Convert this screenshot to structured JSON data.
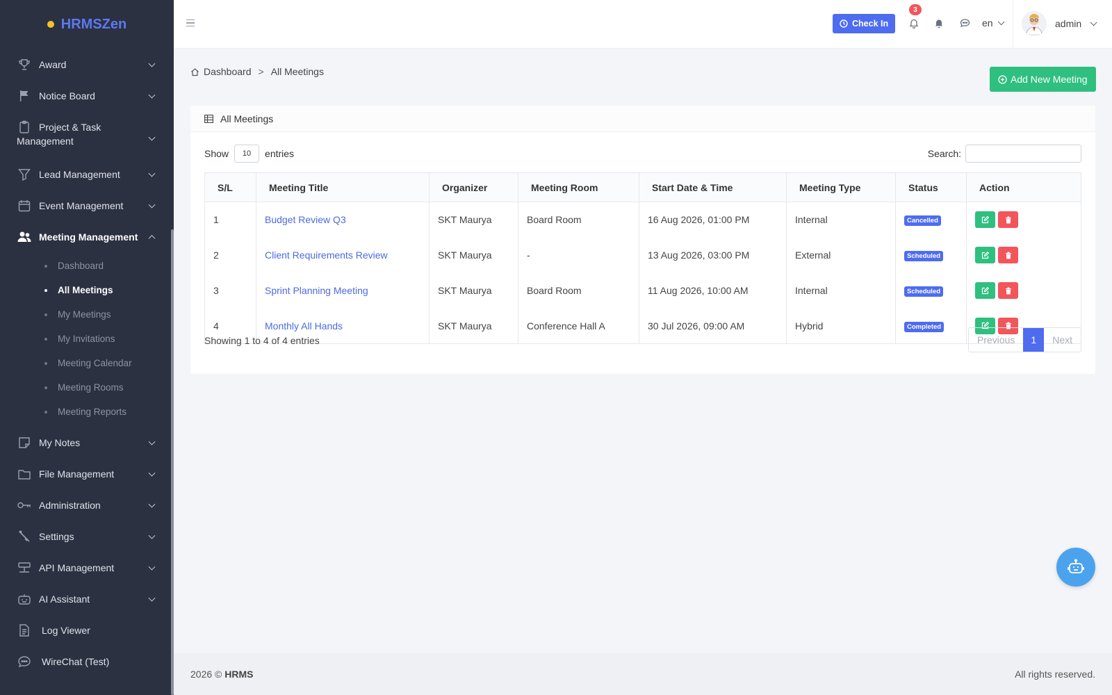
{
  "brand": {
    "name": "HRMSZen"
  },
  "sidebar": {
    "items": [
      {
        "label": "Award",
        "icon": "trophy-icon"
      },
      {
        "label": "Notice Board",
        "icon": "flag-icon"
      },
      {
        "label": "Project & Task",
        "label2": "Management",
        "icon": "clipboard-icon"
      },
      {
        "label": "Lead Management",
        "icon": "funnel-icon"
      },
      {
        "label": "Event Management",
        "icon": "calendar-icon"
      },
      {
        "label": "Meeting Management",
        "icon": "users-icon"
      },
      {
        "label": "My Notes",
        "icon": "note-icon"
      },
      {
        "label": "File Management",
        "icon": "folder-icon"
      },
      {
        "label": "Administration",
        "icon": "key-icon"
      },
      {
        "label": "Settings",
        "icon": "wrench-icon"
      },
      {
        "label": "API Management",
        "icon": "api-icon"
      },
      {
        "label": "AI Assistant",
        "icon": "robot-icon"
      },
      {
        "label": "Log Viewer",
        "icon": "document-icon"
      },
      {
        "label": "WireChat (Test)",
        "icon": "chat-icon"
      }
    ],
    "meeting_sub": [
      "Dashboard",
      "All Meetings",
      "My Meetings",
      "My Invitations",
      "Meeting Calendar",
      "Meeting Rooms",
      "Meeting Reports"
    ]
  },
  "header": {
    "check_in": "Check In",
    "notification_count": "3",
    "lang": "en",
    "user": "admin"
  },
  "breadcrumb": {
    "home": "Dashboard",
    "sep": ">",
    "current": "All Meetings"
  },
  "add_button": "Add New Meeting",
  "card_title": "All Meetings",
  "table_controls": {
    "show": "Show",
    "entries_value": "10",
    "entries": "entries",
    "search": "Search:"
  },
  "columns": [
    "S/L",
    "Meeting Title",
    "Organizer",
    "Meeting Room",
    "Start Date & Time",
    "Meeting Type",
    "Status",
    "Action"
  ],
  "rows": [
    {
      "sl": "1",
      "title": "Budget Review Q3",
      "organizer": "SKT Maurya",
      "room": "Board Room",
      "start": "16 Aug 2026, 01:00 PM",
      "type": "Internal",
      "status": "Cancelled"
    },
    {
      "sl": "2",
      "title": "Client Requirements Review",
      "organizer": "SKT Maurya",
      "room": "-",
      "start": "13 Aug 2026, 03:00 PM",
      "type": "External",
      "status": "Scheduled"
    },
    {
      "sl": "3",
      "title": "Sprint Planning Meeting",
      "organizer": "SKT Maurya",
      "room": "Board Room",
      "start": "11 Aug 2026, 10:00 AM",
      "type": "Internal",
      "status": "Scheduled"
    },
    {
      "sl": "4",
      "title": "Monthly All Hands",
      "organizer": "SKT Maurya",
      "room": "Conference Hall A",
      "start": "30 Jul 2026, 09:00 AM",
      "type": "Hybrid",
      "status": "Completed"
    }
  ],
  "showing": "Showing 1 to 4 of 4 entries",
  "pager": {
    "prev": "Previous",
    "page": "1",
    "next": "Next"
  },
  "footer": {
    "year": "2026 ©",
    "brand": "HRMS",
    "rights": "All rights reserved."
  },
  "colors": {
    "primary": "#4e6cf0",
    "success": "#2fbf7f",
    "danger": "#f2555a",
    "sidebar": "#2c3142"
  }
}
